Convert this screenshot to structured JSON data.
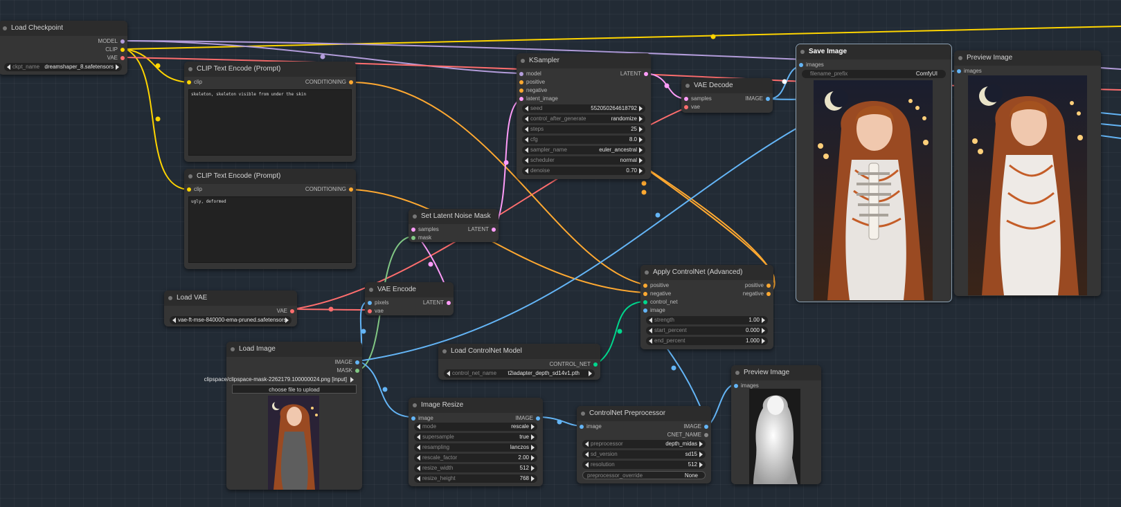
{
  "colors": {
    "model": "#b39ddb",
    "clip": "#ffd500",
    "vae": "#ff6e6e",
    "conditioning": "#ffa931",
    "latent": "#ff9cf9",
    "image": "#64b5f6",
    "mask": "#81c784",
    "control_net": "#00d78d"
  },
  "load_checkpoint": {
    "title": "Load Checkpoint",
    "out_model": "MODEL",
    "out_clip": "CLIP",
    "out_vae": "VAE",
    "ckpt_label": "ckpt_name",
    "ckpt_value": "dreamshaper_8.safetensors"
  },
  "clip_pos": {
    "title": "CLIP Text Encode (Prompt)",
    "in_clip": "clip",
    "out": "CONDITIONING",
    "text": "skeleton, skeleton visible from under the skin"
  },
  "clip_neg": {
    "title": "CLIP Text Encode (Prompt)",
    "in_clip": "clip",
    "out": "CONDITIONING",
    "text": "ugly, deformed"
  },
  "ksampler": {
    "title": "KSampler",
    "in_model": "model",
    "in_positive": "positive",
    "in_negative": "negative",
    "in_latent": "latent_image",
    "out": "LATENT",
    "widgets": [
      {
        "label": "seed",
        "value": "552050264618792"
      },
      {
        "label": "control_after_generate",
        "value": "randomize"
      },
      {
        "label": "steps",
        "value": "25"
      },
      {
        "label": "cfg",
        "value": "8.0"
      },
      {
        "label": "sampler_name",
        "value": "euler_ancestral"
      },
      {
        "label": "scheduler",
        "value": "normal"
      },
      {
        "label": "denoise",
        "value": "0.70"
      }
    ]
  },
  "vae_decode": {
    "title": "VAE Decode",
    "in_samples": "samples",
    "in_vae": "vae",
    "out": "IMAGE"
  },
  "save_image": {
    "title": "Save Image",
    "in_images": "images",
    "prefix_label": "filename_prefix",
    "prefix_value": "ComfyUI"
  },
  "preview_top": {
    "title": "Preview Image",
    "in_images": "images"
  },
  "set_latent_mask": {
    "title": "Set Latent Noise Mask",
    "in_samples": "samples",
    "in_mask": "mask",
    "out": "LATENT"
  },
  "load_vae": {
    "title": "Load VAE",
    "out": "VAE",
    "value": "vae-ft-mse-840000-ema-pruned.safetensors"
  },
  "vae_encode": {
    "title": "VAE Encode",
    "in_pixels": "pixels",
    "in_vae": "vae",
    "out": "LATENT"
  },
  "load_image": {
    "title": "Load Image",
    "out_image": "IMAGE",
    "out_mask": "MASK",
    "image_value": "clipspace/clipspace-mask-2262179.100000024.png [input]",
    "upload_label": "choose file to upload"
  },
  "apply_cn": {
    "title": "Apply ControlNet (Advanced)",
    "in_positive": "positive",
    "in_negative": "negative",
    "in_control": "control_net",
    "in_image": "image",
    "out_positive": "positive",
    "out_negative": "negative",
    "widgets": [
      {
        "label": "strength",
        "value": "1.00"
      },
      {
        "label": "start_percent",
        "value": "0.000"
      },
      {
        "label": "end_percent",
        "value": "1.000"
      }
    ]
  },
  "load_cn_model": {
    "title": "Load ControlNet Model",
    "out": "CONTROL_NET",
    "label": "control_net_name",
    "value": "t2iadapter_depth_sd14v1.pth"
  },
  "image_resize": {
    "title": "Image Resize",
    "in_image": "image",
    "out": "IMAGE",
    "widgets": [
      {
        "label": "mode",
        "value": "rescale"
      },
      {
        "label": "supersample",
        "value": "true"
      },
      {
        "label": "resampling",
        "value": "lanczos"
      },
      {
        "label": "rescale_factor",
        "value": "2.00"
      },
      {
        "label": "resize_width",
        "value": "512"
      },
      {
        "label": "resize_height",
        "value": "768"
      }
    ]
  },
  "cn_preprocessor": {
    "title": "ControlNet Preprocessor",
    "in_image": "image",
    "out_image": "IMAGE",
    "out_cnet": "CNET_NAME",
    "widgets": [
      {
        "label": "preprocessor",
        "value": "depth_midas"
      },
      {
        "label": "sd_version",
        "value": "sd15"
      },
      {
        "label": "resolution",
        "value": "512"
      }
    ],
    "override_label": "preprocessor_override",
    "override_value": "None"
  },
  "preview_depth": {
    "title": "Preview Image",
    "in_images": "images"
  }
}
